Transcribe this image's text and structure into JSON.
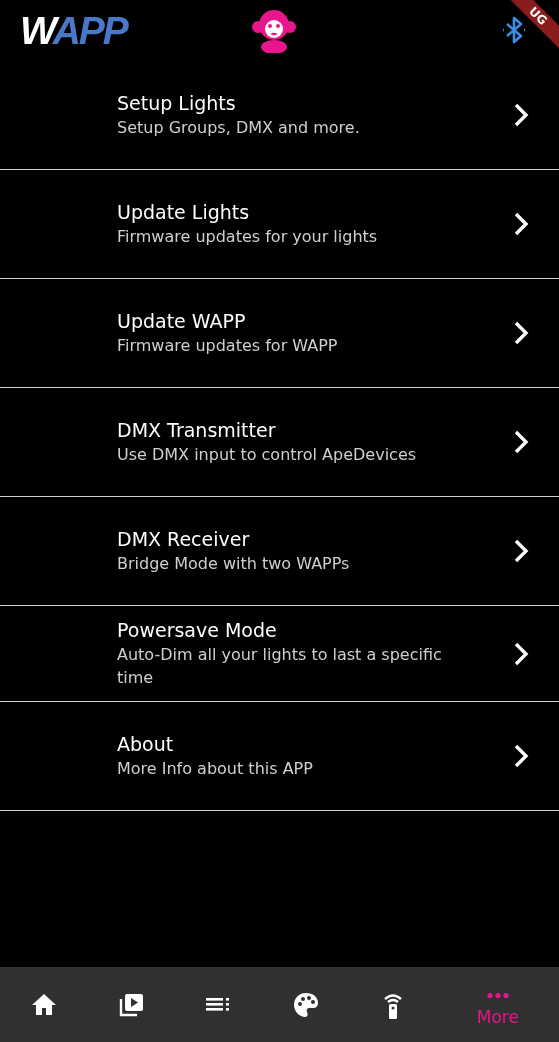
{
  "app_bar": {
    "logo": [
      {
        "text": "W",
        "color": "#ffffff"
      },
      {
        "text": "APP",
        "color": "#4a78c8"
      }
    ],
    "debug_banner": "UG"
  },
  "menu": [
    {
      "title": "Setup Lights",
      "subtitle": "Setup Groups, DMX and more."
    },
    {
      "title": "Update Lights",
      "subtitle": "Firmware updates for your lights"
    },
    {
      "title": "Update WAPP",
      "subtitle": "Firmware updates for WAPP"
    },
    {
      "title": "DMX Transmitter",
      "subtitle": "Use DMX input to control ApeDevices"
    },
    {
      "title": "DMX Receiver",
      "subtitle": "Bridge Mode with two WAPPs"
    },
    {
      "title": "Powersave Mode",
      "subtitle": "Auto-Dim all your lights to last a specific time"
    },
    {
      "title": "About",
      "subtitle": "More Info about this APP"
    }
  ],
  "bottom_nav": [
    {
      "kind": "home",
      "selected": false
    },
    {
      "kind": "playlist",
      "selected": false
    },
    {
      "kind": "list",
      "selected": false
    },
    {
      "kind": "palette",
      "selected": false
    },
    {
      "kind": "remote",
      "selected": false
    },
    {
      "kind": "more",
      "label": "More",
      "selected": true
    }
  ]
}
